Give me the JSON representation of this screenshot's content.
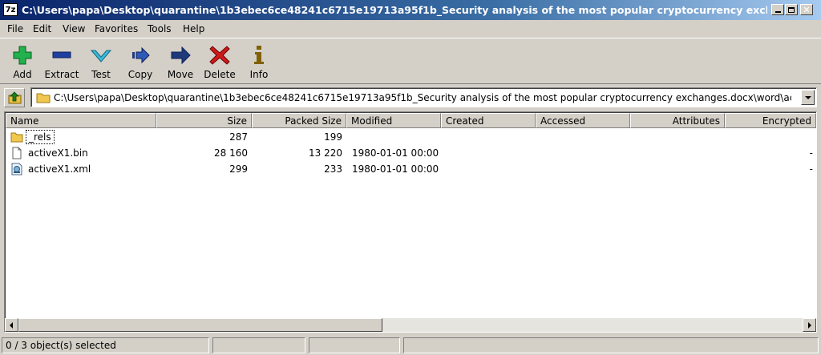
{
  "window": {
    "app_icon": "7z",
    "title": "C:\\Users\\papa\\Desktop\\quarantine\\1b3ebec6ce48241c6715e19713a95f1b_Security analysis of the most popular cryptocurrency exchang..."
  },
  "menu": [
    "File",
    "Edit",
    "View",
    "Favorites",
    "Tools",
    "Help"
  ],
  "toolbar": [
    {
      "label": "Add",
      "icon": "plus-icon",
      "color": "#22b14c"
    },
    {
      "label": "Extract",
      "icon": "minus-icon",
      "color": "#1f3fa0"
    },
    {
      "label": "Test",
      "icon": "check-icon",
      "color": "#3fb7d6"
    },
    {
      "label": "Copy",
      "icon": "copy-arrow-icon",
      "color": "#1f3a7a"
    },
    {
      "label": "Move",
      "icon": "move-arrow-icon",
      "color": "#1f3a7a"
    },
    {
      "label": "Delete",
      "icon": "delete-x-icon",
      "color": "#cc1a1a"
    },
    {
      "label": "Info",
      "icon": "info-icon",
      "color": "#806000"
    }
  ],
  "address": {
    "path": "C:\\Users\\papa\\Desktop\\quarantine\\1b3ebec6ce48241c6715e19713a95f1b_Security analysis of the most popular cryptocurrency exchanges.docx\\word\\activeX\\"
  },
  "columns": [
    "Name",
    "Size",
    "Packed Size",
    "Modified",
    "Created",
    "Accessed",
    "Attributes",
    "Encrypted"
  ],
  "files": [
    {
      "name": "_rels",
      "size": "287",
      "packed": "199",
      "modified": "",
      "created": "",
      "accessed": "",
      "attributes": "",
      "encrypted": "",
      "icon": "folder-icon"
    },
    {
      "name": "activeX1.bin",
      "size": "28 160",
      "packed": "13 220",
      "modified": "1980-01-01 00:00",
      "created": "",
      "accessed": "",
      "attributes": "",
      "encrypted": "-",
      "icon": "file-icon"
    },
    {
      "name": "activeX1.xml",
      "size": "299",
      "packed": "233",
      "modified": "1980-01-01 00:00",
      "created": "",
      "accessed": "",
      "attributes": "",
      "encrypted": "-",
      "icon": "xml-file-icon"
    }
  ],
  "status": {
    "selection": "0 / 3 object(s) selected"
  }
}
